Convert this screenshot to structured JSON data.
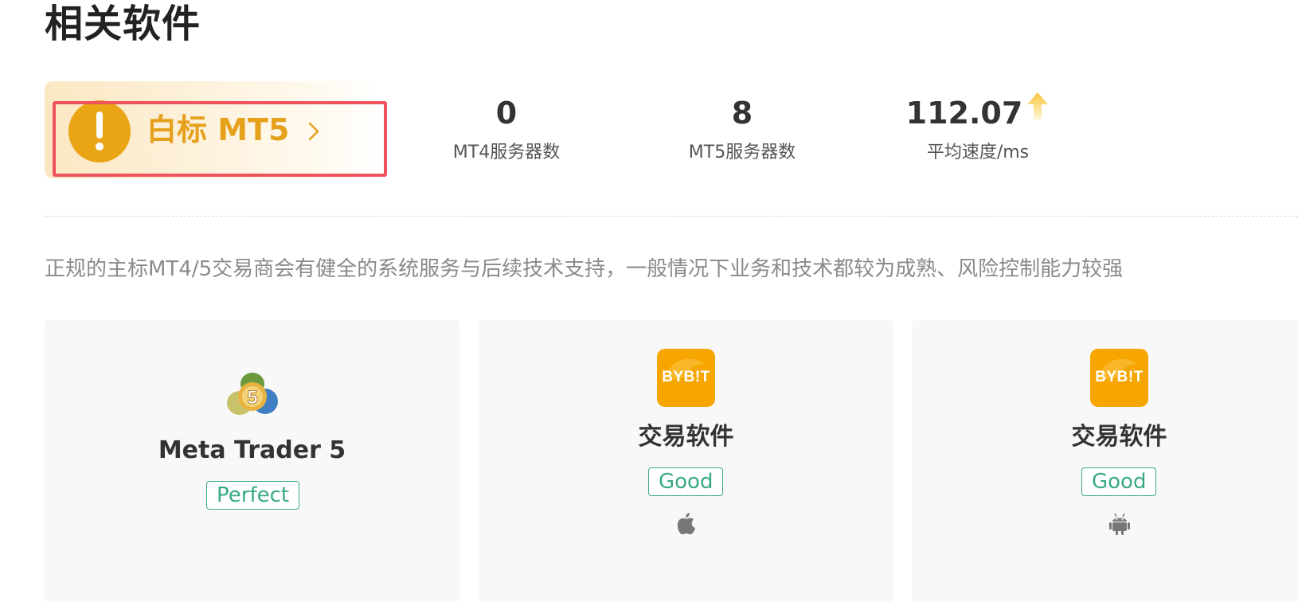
{
  "section": {
    "title": "相关软件"
  },
  "badge": {
    "label": "白标 MT5",
    "color": "#e9a514",
    "highlight_color": "#f0535c"
  },
  "stats": [
    {
      "value": "0",
      "label": "MT4服务器数"
    },
    {
      "value": "8",
      "label": "MT5服务器数"
    },
    {
      "value": "112.07",
      "label": "平均速度/ms",
      "trend": "up"
    }
  ],
  "description": "正规的主标MT4/5交易商会有健全的系统服务与后续技术支持，一般情况下业务和技术都较为成熟、风险控制能力较强",
  "cards": [
    {
      "title": "Meta Trader 5",
      "rating": "Perfect",
      "logo": "metatrader5-logo"
    },
    {
      "title": "交易软件",
      "rating": "Good",
      "logo": "bybit-logo",
      "logo_text": "BYB!T",
      "platform": "apple-icon"
    },
    {
      "title": "交易软件",
      "rating": "Good",
      "logo": "bybit-logo",
      "logo_text": "BYB!T",
      "platform": "android-icon"
    }
  ],
  "colors": {
    "accent": "#e6a11c",
    "rating": "#3aa987",
    "bybit": "#f7a600"
  }
}
